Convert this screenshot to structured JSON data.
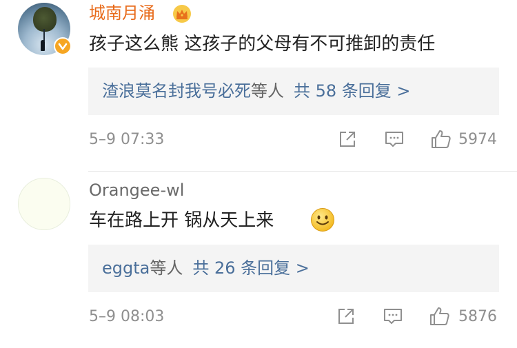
{
  "comments": [
    {
      "username": "城南月涌",
      "vip_badge": "crown-icon",
      "verified_badge": "verified-v-icon",
      "text": "孩子这么熊 这孩子的父母有不可推卸的责任",
      "replies": {
        "who": "渣浪莫名封我号必死",
        "suffix": "等人",
        "count_text": "共 58 条回复 >"
      },
      "time": "5–9 07:33",
      "likes": "5974"
    },
    {
      "username": "Orangee-wl",
      "text": "车在路上开 锅从天上来",
      "emoji": "smiley-face-icon",
      "replies": {
        "who": "eggta",
        "suffix": "等人",
        "count_text": "共 26 条回复 >"
      },
      "time": "5–9 08:03",
      "likes": "5876"
    }
  ],
  "colors": {
    "vip_name": "#e86b1b",
    "link_blue": "#4a6f9a",
    "meta_grey": "#8f8f8f",
    "reply_box_bg": "#f4f4f4",
    "verified_badge": "#f6a623"
  },
  "icons": [
    "share-icon",
    "comment-icon",
    "thumbs-up-icon"
  ]
}
